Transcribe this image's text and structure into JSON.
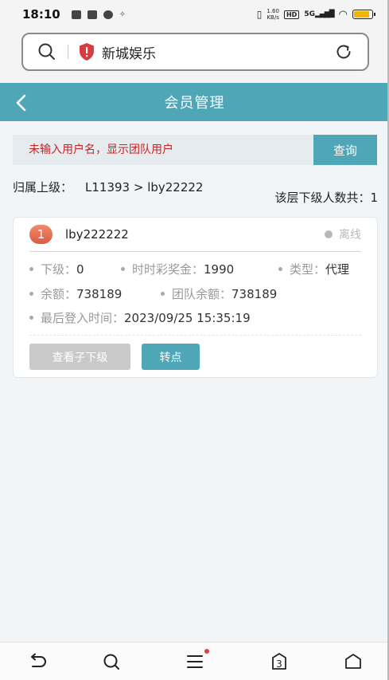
{
  "status_bar": {
    "time": "18:10",
    "net_speed_value": "1.60",
    "net_speed_unit": "KB/s",
    "hd_label": "HD",
    "signal_label": "5G",
    "battery_level": 0.85,
    "battery_color": "#f2b600"
  },
  "browser": {
    "page_title": "新城娱乐",
    "security_icon": "warning-shield-icon",
    "security_color": "#d93c3c"
  },
  "header": {
    "title": "会员管理"
  },
  "search": {
    "placeholder": "未输入用户名，显示团队用户",
    "button_label": "查询"
  },
  "breadcrumb": {
    "label": "归属上级：",
    "value": "L11393 > lby22222"
  },
  "level_count": {
    "text": "该层下级人数共：1"
  },
  "members": [
    {
      "index": "1",
      "username": "lby222222",
      "status": "离线",
      "fields": {
        "sub_level_label": "下级：",
        "sub_level_value": "0",
        "bonus_label": "时时彩奖金：",
        "bonus_value": "1990",
        "type_label": "类型：",
        "type_value": "代理",
        "balance_label": "余额：",
        "balance_value": "738189",
        "team_balance_label": "团队余额：",
        "team_balance_value": "738189",
        "last_login_label": "最后登入时间：",
        "last_login_value": "2023/09/25 15:35:19"
      },
      "actions": {
        "view_sub_label": "查看子下级",
        "transfer_label": "转点"
      }
    }
  ],
  "bottom_nav": {
    "tab_count": "3"
  },
  "colors": {
    "accent": "#4ea6b7",
    "placeholder_red": "#c62525",
    "index_badge": "#e4684b"
  }
}
